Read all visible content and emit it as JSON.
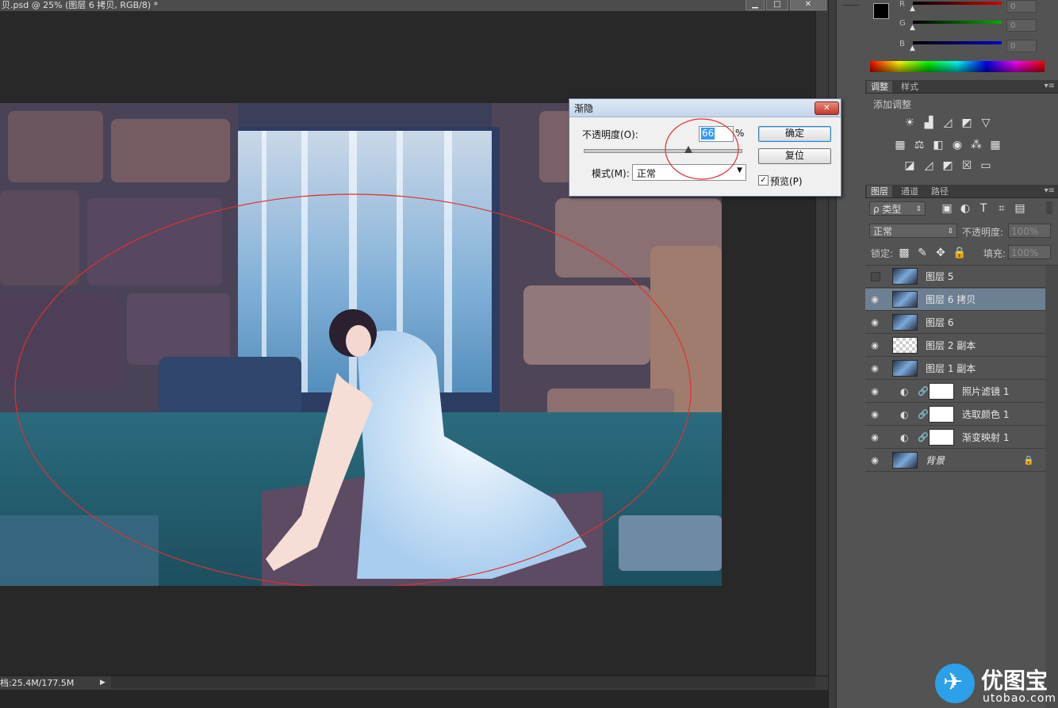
{
  "document": {
    "title": "贝.psd @ 25% (图层 6 拷贝, RGB/8) *",
    "window_buttons": [
      "▁",
      "□",
      "✕"
    ],
    "status": "档:25.4M/177.5M",
    "status_arrow": "▶"
  },
  "fade_dialog": {
    "title": "渐隐",
    "opacity_label": "不透明度(O):",
    "opacity_value": "66",
    "percent_sign": "%",
    "opacity_level": 0.66,
    "mode_label": "模式(M):",
    "mode_value": "正常",
    "ok_label": "确定",
    "reset_label": "复位",
    "preview_label": "预览(P)",
    "preview_checked": true,
    "close_glyph": "✕"
  },
  "color_panel": {
    "channels": [
      {
        "name": "R",
        "value": "0",
        "color": "#cc0000"
      },
      {
        "name": "G",
        "value": "0",
        "color": "#00aa00"
      },
      {
        "name": "B",
        "value": "0",
        "color": "#0000cc"
      }
    ]
  },
  "adjustments_panel": {
    "tabs": [
      "调整",
      "样式"
    ],
    "heading": "添加调整",
    "icons": [
      [
        "brightness-icon",
        "levels-icon",
        "curves-icon",
        "exposure-icon",
        "vibrance-icon"
      ],
      [
        "hue-saturation-icon",
        "color-balance-icon",
        "black-white-icon",
        "photo-filter-icon",
        "channel-mixer-icon",
        "color-lookup-icon"
      ],
      [
        "invert-icon",
        "posterize-icon",
        "threshold-icon",
        "selective-color-icon",
        "gradient-map-icon"
      ]
    ]
  },
  "layers_panel": {
    "tabs": [
      "图层",
      "通道",
      "路径"
    ],
    "filter_kind": "ρ 类型",
    "blend_mode": "正常",
    "opacity_label": "不透明度:",
    "opacity_value": "100%",
    "lock_label": "锁定:",
    "fill_label": "填充:",
    "fill_value": "100%",
    "layers": [
      {
        "name": "图层 5",
        "visible": false,
        "selected": false,
        "type": "image"
      },
      {
        "name": "图层 6 拷贝",
        "visible": true,
        "selected": true,
        "type": "image"
      },
      {
        "name": "图层 6",
        "visible": true,
        "selected": false,
        "type": "image"
      },
      {
        "name": "图层 2 副本",
        "visible": true,
        "selected": false,
        "type": "transparent"
      },
      {
        "name": "图层 1 副本",
        "visible": true,
        "selected": false,
        "type": "image"
      },
      {
        "name": "照片滤镜 1",
        "visible": true,
        "selected": false,
        "type": "adjustment"
      },
      {
        "name": "选取颜色 1",
        "visible": true,
        "selected": false,
        "type": "adjustment"
      },
      {
        "name": "渐变映射 1",
        "visible": true,
        "selected": false,
        "type": "adjustment"
      },
      {
        "name": "背景",
        "visible": true,
        "selected": false,
        "type": "background"
      }
    ]
  },
  "watermark": {
    "brand": "优图宝",
    "url": "utobao.com"
  }
}
